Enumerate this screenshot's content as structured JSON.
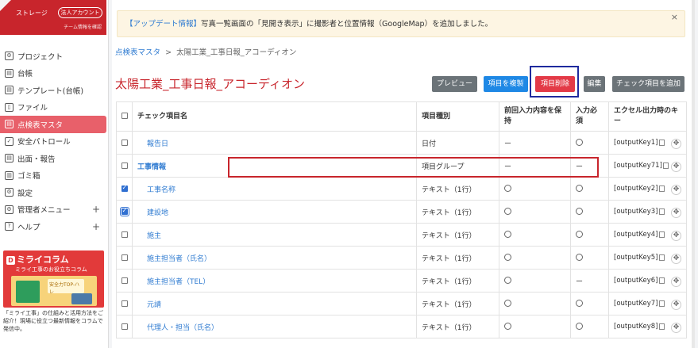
{
  "sidebar": {
    "storage_label": "ストレージ",
    "corp_badge": "法人アカウント",
    "team_label": "チーム情報を確認",
    "items": [
      {
        "label": "プロジェクト",
        "icon": "project-icon"
      },
      {
        "label": "台帳",
        "icon": "ledger-icon"
      },
      {
        "label": "テンプレート(台帳)",
        "icon": "template-icon"
      },
      {
        "label": "ファイル",
        "icon": "file-icon"
      },
      {
        "label": "点検表マスタ",
        "icon": "checklist-icon",
        "active": true
      },
      {
        "label": "安全パトロール",
        "icon": "patrol-icon"
      },
      {
        "label": "出面・報告",
        "icon": "report-icon"
      },
      {
        "label": "ゴミ箱",
        "icon": "trash-icon"
      },
      {
        "label": "設定",
        "icon": "gear-icon"
      },
      {
        "label": "管理者メニュー",
        "icon": "admin-icon",
        "expandable": true
      },
      {
        "label": "ヘルプ",
        "icon": "help-icon",
        "expandable": true
      }
    ],
    "banner": {
      "logo": "ミライコラム",
      "logo_mark": "D",
      "subtitle": "ミライ工事のお役立ちコラム",
      "caption": "安全力TOP-ハレ",
      "text": "「ミライ工事」の仕組みと活用方法をご紹介！現場に役立つ最新情報をコラムで発信中。"
    }
  },
  "notice": {
    "tag": "【アップデート情報】",
    "text": "写真一覧画面の「見開き表示」に撮影者と位置情報（GoogleMap）を追加しました。",
    "close": "×"
  },
  "breadcrumb": {
    "link": "点検表マスタ",
    "separator": ">",
    "current": "太陽工業_工事日報_アコーディオン"
  },
  "page_title": "太陽工業_工事日報_アコーディオン",
  "toolbar": {
    "preview": "プレビュー",
    "copy": "項目を複製",
    "delete": "項目削除",
    "edit": "編集",
    "add": "チェック項目を追加"
  },
  "table": {
    "headers": [
      "チェック項目名",
      "項目種別",
      "前回入力内容を保持",
      "入力必須",
      "エクセル出力時のキー"
    ],
    "rows": [
      {
        "checked": false,
        "name": "報告日",
        "type": "日付",
        "keep": "ー",
        "required": "circle",
        "key": "[outputKey1]"
      },
      {
        "checked": false,
        "name": "工事情報",
        "type": "項目グループ",
        "keep": "ー",
        "required": "ー",
        "key": "[outputKey71]",
        "group": true
      },
      {
        "checked": true,
        "name": "工事名称",
        "type": "テキスト（1行）",
        "keep": "circle",
        "required": "circle",
        "key": "[outputKey2]"
      },
      {
        "checked": true,
        "name": "建設地",
        "type": "テキスト（1行）",
        "keep": "circle",
        "required": "circle",
        "key": "[outputKey3]",
        "focus": true
      },
      {
        "checked": false,
        "name": "施主",
        "type": "テキスト（1行）",
        "keep": "circle",
        "required": "circle",
        "key": "[outputKey4]"
      },
      {
        "checked": false,
        "name": "施主担当者（氏名）",
        "type": "テキスト（1行）",
        "keep": "circle",
        "required": "circle",
        "key": "[outputKey5]"
      },
      {
        "checked": false,
        "name": "施主担当者（TEL）",
        "type": "テキスト（1行）",
        "keep": "circle",
        "required": "ー",
        "key": "[outputKey6]"
      },
      {
        "checked": false,
        "name": "元請",
        "type": "テキスト（1行）",
        "keep": "circle",
        "required": "circle",
        "key": "[outputKey7]"
      },
      {
        "checked": false,
        "name": "代理人・担当（氏名）",
        "type": "テキスト（1行）",
        "keep": "circle",
        "required": "circle",
        "key": "[outputKey8]"
      }
    ]
  },
  "colors": {
    "brand_red": "#c8252c",
    "link_blue": "#2f7bd1",
    "delete_red": "#e33a47",
    "copy_blue": "#1e88e5",
    "highlight_navy": "#1f2a9e"
  }
}
